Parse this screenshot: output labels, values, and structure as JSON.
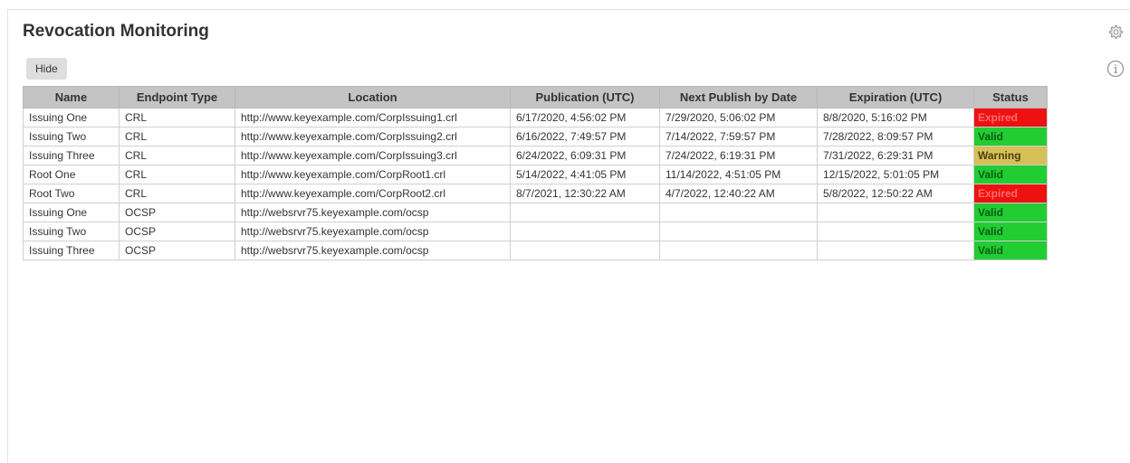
{
  "widget": {
    "title": "Revocation Monitoring",
    "hide_label": "Hide",
    "settings_icon": "gear-icon",
    "info_icon": "info-circle-icon"
  },
  "table": {
    "columns": [
      "Name",
      "Endpoint Type",
      "Location",
      "Publication (UTC)",
      "Next Publish by Date",
      "Expiration (UTC)",
      "Status"
    ],
    "rows": [
      {
        "name": "Issuing One",
        "type": "CRL",
        "location": "http://www.keyexample.com/CorpIssuing1.crl",
        "publication": "6/17/2020, 4:56:02 PM",
        "next_publish": "7/29/2020, 5:06:02 PM",
        "expiration": "8/8/2020, 5:16:02 PM",
        "status": "Expired",
        "status_class": "expired"
      },
      {
        "name": "Issuing Two",
        "type": "CRL",
        "location": "http://www.keyexample.com/CorpIssuing2.crl",
        "publication": "6/16/2022, 7:49:57 PM",
        "next_publish": "7/14/2022, 7:59:57 PM",
        "expiration": "7/28/2022, 8:09:57 PM",
        "status": "Valid",
        "status_class": "valid"
      },
      {
        "name": "Issuing Three",
        "type": "CRL",
        "location": "http://www.keyexample.com/CorpIssuing3.crl",
        "publication": "6/24/2022, 6:09:31 PM",
        "next_publish": "7/24/2022, 6:19:31 PM",
        "expiration": "7/31/2022, 6:29:31 PM",
        "status": "Warning",
        "status_class": "warning"
      },
      {
        "name": "Root One",
        "type": "CRL",
        "location": "http://www.keyexample.com/CorpRoot1.crl",
        "publication": "5/14/2022, 4:41:05 PM",
        "next_publish": "11/14/2022, 4:51:05 PM",
        "expiration": "12/15/2022, 5:01:05 PM",
        "status": "Valid",
        "status_class": "valid"
      },
      {
        "name": "Root Two",
        "type": "CRL",
        "location": "http://www.keyexample.com/CorpRoot2.crl",
        "publication": "8/7/2021, 12:30:22 AM",
        "next_publish": "4/7/2022, 12:40:22 AM",
        "expiration": "5/8/2022, 12:50:22 AM",
        "status": "Expired",
        "status_class": "expired"
      },
      {
        "name": "Issuing One",
        "type": "OCSP",
        "location": "http://websrvr75.keyexample.com/ocsp",
        "publication": "",
        "next_publish": "",
        "expiration": "",
        "status": "Valid",
        "status_class": "valid"
      },
      {
        "name": "Issuing Two",
        "type": "OCSP",
        "location": "http://websrvr75.keyexample.com/ocsp",
        "publication": "",
        "next_publish": "",
        "expiration": "",
        "status": "Valid",
        "status_class": "valid"
      },
      {
        "name": "Issuing Three",
        "type": "OCSP",
        "location": "http://websrvr75.keyexample.com/ocsp",
        "publication": "",
        "next_publish": "",
        "expiration": "",
        "status": "Valid",
        "status_class": "valid"
      }
    ]
  },
  "colors": {
    "header_bg": "#c4c4c4",
    "expired": "#ee1111",
    "valid": "#22cc33",
    "warning": "#d7bf57"
  }
}
